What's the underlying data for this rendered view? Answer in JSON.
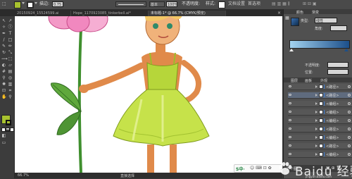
{
  "control_bar": {
    "fill_color": "#a8c22f",
    "stroke_color": "#2a2a2a",
    "stroke_weight": "0.75",
    "stroke_label": "描边:",
    "opacity_value": "100%",
    "opacity_label": "不透明度:",
    "style_label": "样式:",
    "basic_label": "基本",
    "doc_settings_label": "文档设置",
    "preferences_label": "首选项"
  },
  "tabs": [
    {
      "label": "20150924_15524599.ai"
    },
    {
      "label": "Hope_1170923085_tinkerbell.ai*"
    },
    {
      "label": "未标题-1* @ 66.7% (CMYK/预览)",
      "active": true
    }
  ],
  "canvas": {
    "zoom": "66.7%",
    "status_text": "直接选择"
  },
  "right_panel": {
    "color_mode_label": "颜色",
    "gradient_label": "渐变",
    "type_label": "类型:",
    "type_value": "线性",
    "angle_label": "角度:",
    "opacity_label": "不透明度:",
    "location_label": "位置:",
    "layers_tabs": [
      "图层",
      "画板",
      "外观"
    ],
    "layer_count_text": "7 个图层",
    "layer_rows": [
      {
        "name": "<路径>",
        "selected": false
      },
      {
        "name": "<路径>",
        "selected": true
      },
      {
        "name": "<编组>",
        "selected": false
      },
      {
        "name": "<编组>",
        "selected": false
      },
      {
        "name": "<编组>",
        "selected": false
      },
      {
        "name": "<路径>",
        "selected": false
      },
      {
        "name": "<编组>",
        "selected": false
      },
      {
        "name": "<路径>",
        "selected": false
      },
      {
        "name": "<编组>",
        "selected": false
      }
    ]
  },
  "ime_bar": {
    "label": "S中·"
  },
  "watermark": {
    "text": "Baidu 经验",
    "sub": "jingyan.baidu.com"
  },
  "colors": {
    "canvas_bg": "#ffffff",
    "ui_dark": "#3a3a3a",
    "dress_green": "#b6d63a",
    "skin": "#e08a4a",
    "hair": "#f3c766",
    "petal_pink": "#f39ac7",
    "leaf_green": "#4f9a3a"
  }
}
